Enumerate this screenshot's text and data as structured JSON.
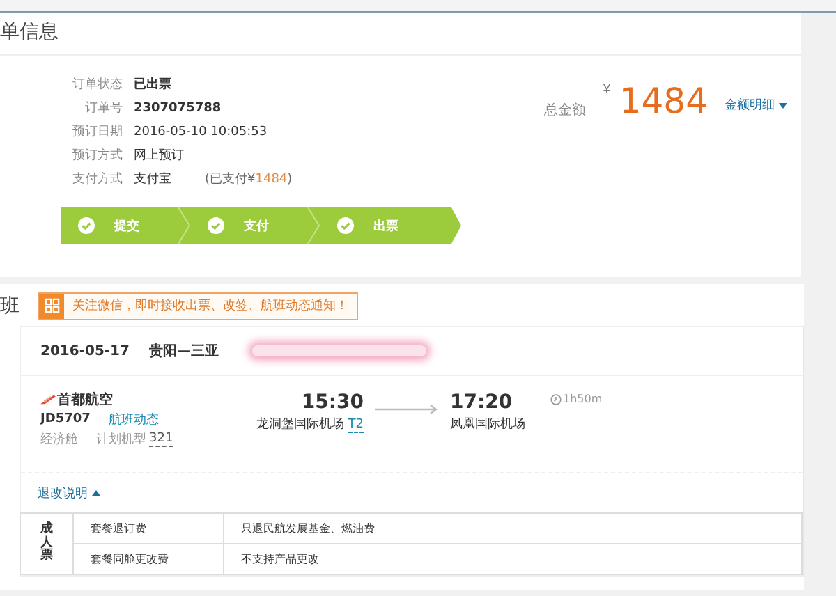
{
  "order_section": {
    "title": "单信息",
    "fields": [
      {
        "label": "订单状态",
        "value": "已出票",
        "bold": true
      },
      {
        "label": "订单号",
        "value": "2307075788",
        "bold": true
      },
      {
        "label": "预订日期",
        "value": "2016-05-10 10:05:53",
        "bold": false
      },
      {
        "label": "预订方式",
        "value": "网上预订",
        "bold": false
      },
      {
        "label": "支付方式",
        "value": "支付宝",
        "bold": false
      }
    ],
    "paid_note": {
      "prefix": "(已支付¥",
      "amount": "1484",
      "suffix": ")"
    },
    "total": {
      "label": "总金额",
      "currency": "¥",
      "amount": "1484",
      "detail_link": "金额明细",
      "expanded": false
    },
    "steps": [
      {
        "label": "提交",
        "done": true
      },
      {
        "label": "支付",
        "done": true
      },
      {
        "label": "出票",
        "done": true
      }
    ]
  },
  "flight_section": {
    "title": "班",
    "notice": "关注微信，即时接收出票、改签、航班动态通知！",
    "date": "2016-05-17",
    "route": "贵阳—三亚",
    "flight": {
      "airline": "首都航空",
      "flight_no": "JD5707",
      "status_link": "航班动态",
      "cabin": "经济舱",
      "aircraft_label": "计划机型",
      "aircraft": "321",
      "departure": {
        "time": "15:30",
        "airport": "龙洞堡国际机场",
        "terminal": "T2"
      },
      "arrival": {
        "time": "17:20",
        "airport": "凤凰国际机场"
      },
      "duration": "1h50m"
    },
    "rules": {
      "toggle": "退改说明",
      "expanded": true,
      "passenger_type": "成人票",
      "rows": [
        {
          "item": "套餐退订费",
          "rule": "只退民航发展基金、燃油费"
        },
        {
          "item": "套餐同舱更改费",
          "rule": "不支持产品更改"
        }
      ]
    }
  }
}
